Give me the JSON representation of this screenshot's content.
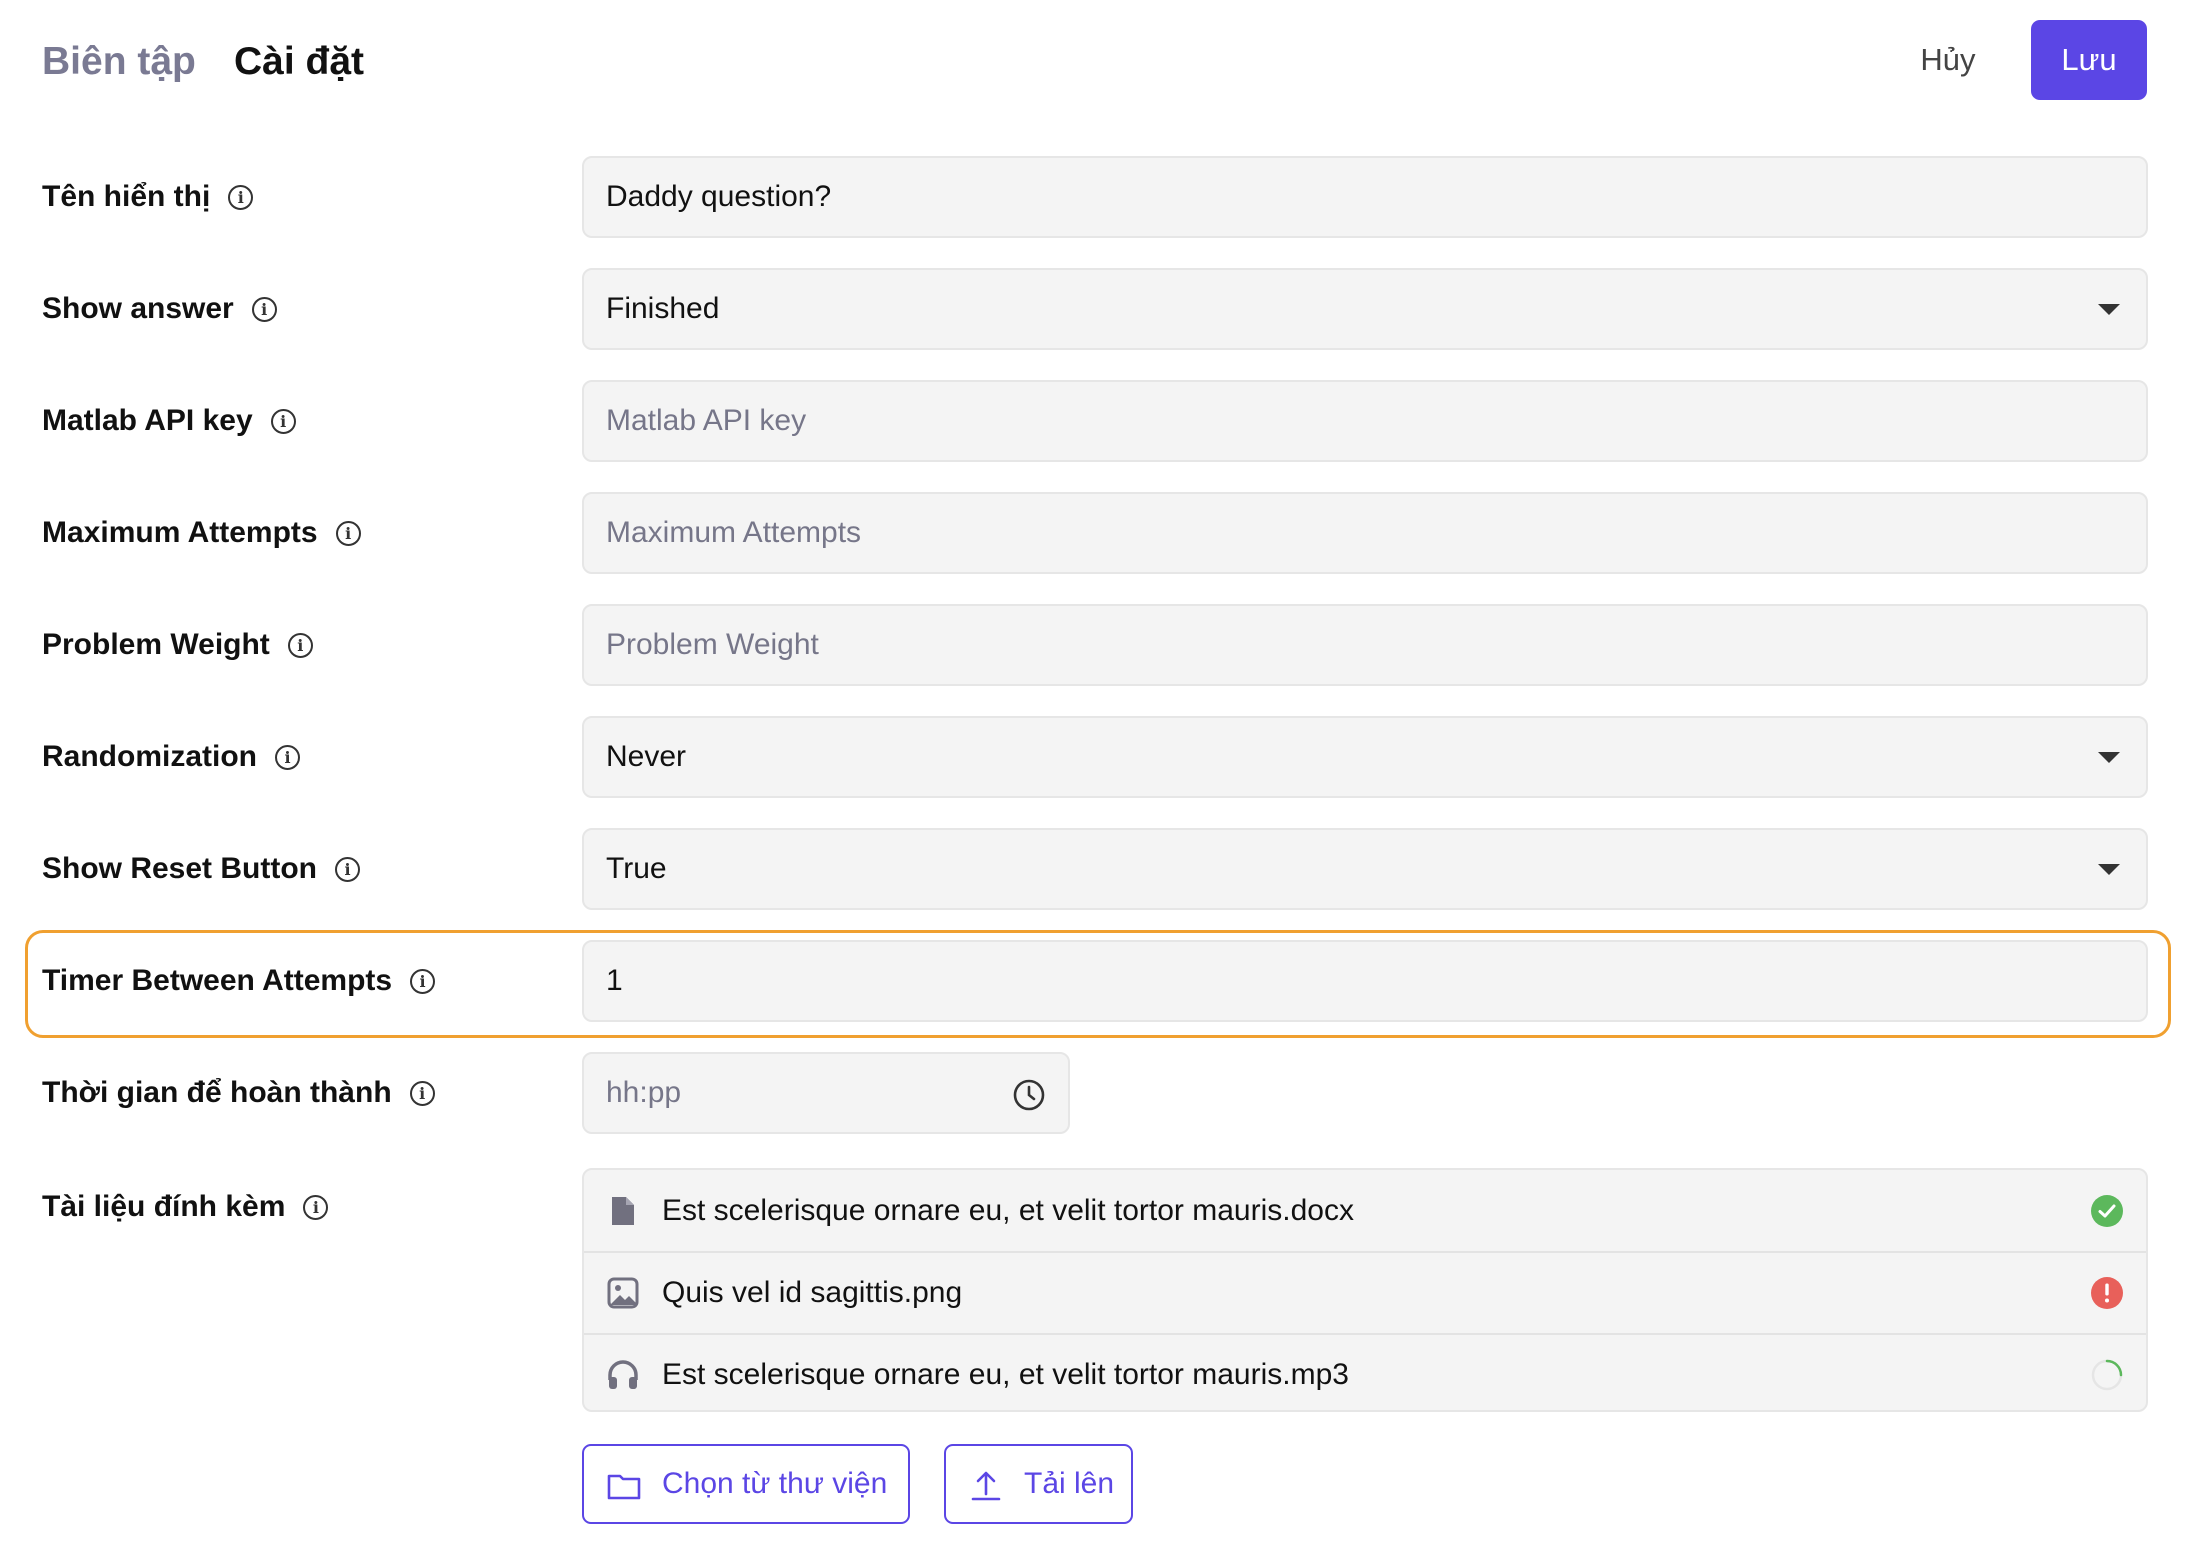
{
  "header": {
    "tabs": [
      "Biên tập",
      "Cài đặt"
    ],
    "cancel_label": "Hủy",
    "save_label": "Lưu"
  },
  "settings": [
    {
      "label": "Tên hiển thị",
      "value": "Daddy question?",
      "placeholder": "",
      "type": "text"
    },
    {
      "label": "Show answer",
      "value": "Finished",
      "placeholder": "",
      "type": "select"
    },
    {
      "label": "Matlab API key",
      "value": "",
      "placeholder": "Matlab API key",
      "type": "text"
    },
    {
      "label": "Maximum Attempts",
      "value": "",
      "placeholder": "Maximum Attempts",
      "type": "text"
    },
    {
      "label": "Problem Weight",
      "value": "",
      "placeholder": "Problem Weight",
      "type": "text"
    },
    {
      "label": "Randomization",
      "value": "Never",
      "placeholder": "",
      "type": "select"
    },
    {
      "label": "Show Reset Button",
      "value": "True",
      "placeholder": "",
      "type": "select"
    },
    {
      "label": "Timer Between Attempts",
      "value": "1",
      "placeholder": "",
      "type": "text"
    }
  ],
  "completion_time": {
    "label": "Thời gian để hoàn thành",
    "placeholder": "hh:pp",
    "icon": "clock-icon"
  },
  "attachments": {
    "label": "Tài liệu đính kèm",
    "items": [
      {
        "name": "Est scelerisque ornare eu, et velit tortor mauris.docx",
        "icon": "document-icon",
        "status": "success"
      },
      {
        "name": "Quis vel id sagittis.png",
        "icon": "image-icon",
        "status": "error"
      },
      {
        "name": "Est scelerisque ornare eu, et velit tortor mauris.mp3",
        "icon": "headphones-icon",
        "status": "loading"
      }
    ],
    "choose_label": "Chọn từ thư viện",
    "upload_label": "Tải lên"
  },
  "colors": {
    "accent": "#5b46e5",
    "highlight": "#f0a030",
    "success": "#5cb85c",
    "error": "#e8605a"
  }
}
